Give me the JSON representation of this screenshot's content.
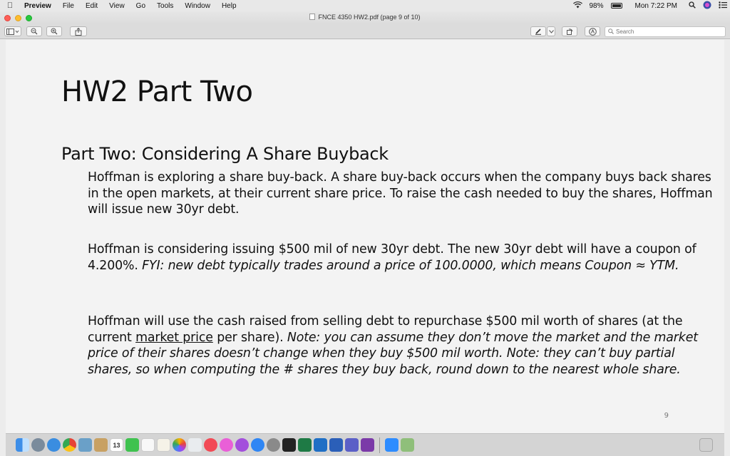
{
  "menubar": {
    "app_name": "Preview",
    "menus": [
      "File",
      "Edit",
      "View",
      "Go",
      "Tools",
      "Window",
      "Help"
    ],
    "battery": "98%",
    "clock": "Mon 7:22 PM"
  },
  "window": {
    "title": "FNCE 4350 HW2.pdf (page 9 of 10)"
  },
  "toolbar": {
    "search_placeholder": "Search"
  },
  "document": {
    "title": "HW2 Part Two",
    "section_heading": "Part Two: Considering A Share Buyback",
    "p1": "Hoffman is exploring a share buy-back.  A share buy-back occurs when the company buys back shares in the open markets, at their current share price.  To raise the cash needed to buy the shares, Hoffman will issue new 30yr debt.",
    "p2_normal": "Hoffman is considering issuing $500 mil of new 30yr debt. The new 30yr debt will have a coupon of 4.200%.  ",
    "p2_italic": "FYI: new debt typically trades around a price of 100.0000, which means Coupon ≈ YTM.",
    "p3_normal_a": "Hoffman will use the cash raised from selling debt to repurchase $500 mil worth of shares (at the current ",
    "p3_underlined": "market price",
    "p3_normal_b": " per share).  ",
    "p3_italic": "Note: you can assume they don’t move the market and the market price of their shares doesn’t change when they buy $500 mil worth.  Note: they can’t buy partial shares, so when computing the # shares they buy back, round down to the nearest whole share.",
    "page_number": "9"
  },
  "dock": {
    "calendar_day": "13",
    "icons": [
      "finder-icon",
      "launchpad-icon",
      "safari-icon",
      "chrome-icon",
      "preview-icon",
      "notes-icon",
      "calendar-icon",
      "messages-icon",
      "reminders-icon",
      "contacts-icon",
      "photos-icon",
      "numbers-icon",
      "news-icon",
      "itunes-icon",
      "podcasts-icon",
      "appstore-icon",
      "system-preferences-icon",
      "terminal-icon",
      "excel-icon",
      "outlook-icon",
      "word-icon",
      "teams-icon",
      "onenote-icon",
      "zoom-icon",
      "maps-icon",
      "trash-icon"
    ]
  },
  "colors": {
    "page_bg": "#f3f3f3",
    "text": "#111111",
    "close": "#ff5f57",
    "minimize": "#febc2e",
    "maximize": "#28c840"
  }
}
